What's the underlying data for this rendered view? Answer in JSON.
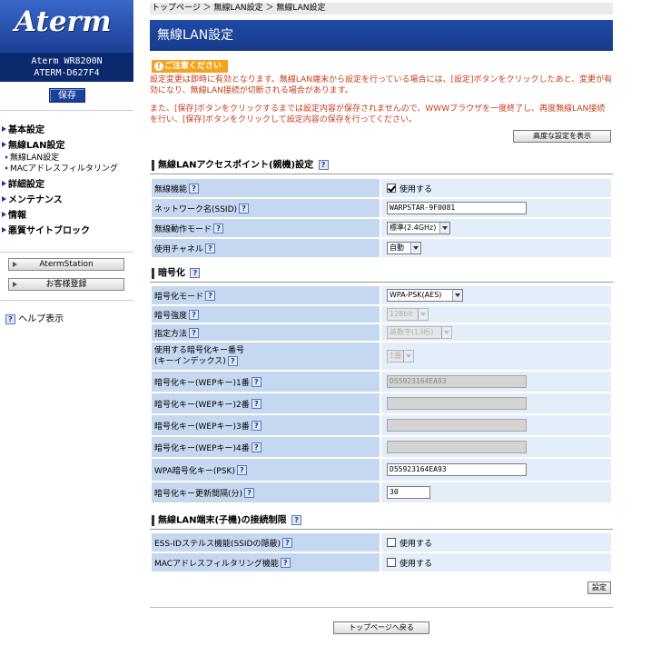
{
  "sidebar": {
    "logo": "Aterm",
    "model_line1": "Aterm WR8200N",
    "model_line2": "ATERM-D627F4",
    "save_label": "保存",
    "menu": {
      "basic": "基本設定",
      "wireless": "無線LAN設定",
      "wireless_sub1": "無線LAN設定",
      "wireless_sub2": "MACアドレスフィルタリング",
      "advanced": "詳細設定",
      "maintenance": "メンテナンス",
      "info": "情報",
      "block": "悪質サイトブロック"
    },
    "aterm_station": "AtermStation",
    "customer_reg": "お客様登録",
    "help": "ヘルプ表示"
  },
  "breadcrumb": "トップページ ＞ 無線LAN設定 ＞ 無線LAN設定",
  "page_title": "無線LAN設定",
  "caution": "ご注意ください",
  "notice1": "設定変更は即時に有効となります。無線LAN端末から設定を行っている場合には、[設定]ボタンをクリックしたあと、変更が有効になり、無線LAN接続が切断される場合があります。",
  "notice2": "また、[保存]ボタンをクリックするまでは設定内容が保存されませんので、WWWブラウザを一度終了し、再度無線LAN接続を行い、[保存]ボタンをクリックして設定内容の保存を行ってください。",
  "advanced_button": "高度な設定を表示",
  "sections": {
    "ap": "無線LANアクセスポイント(親機)設定",
    "enc": "暗号化",
    "client": "無線LAN端末(子機)の接続制限"
  },
  "fields": {
    "wireless_func": {
      "label": "無線機能",
      "value": "使用する"
    },
    "ssid": {
      "label": "ネットワーク名(SSID)",
      "value": "WARPSTAR-9F0081"
    },
    "mode": {
      "label": "無線動作モード",
      "value": "標準(2.4GHz)"
    },
    "channel": {
      "label": "使用チャネル",
      "value": "自動"
    },
    "enc_mode": {
      "label": "暗号化モード",
      "value": "WPA-PSK(AES)"
    },
    "enc_strength": {
      "label": "暗号強度",
      "value": "128bit"
    },
    "spec_method": {
      "label": "指定方法",
      "value": "英数字(13桁)"
    },
    "key_index_l1": "使用する暗号化キー番号",
    "key_index_l2": "(キーインデックス)",
    "key_index_value": "1番",
    "wep1": {
      "label": "暗号化キー(WEPキー)1番",
      "value": "D55923164EA93"
    },
    "wep2": {
      "label": "暗号化キー(WEPキー)2番",
      "value": ""
    },
    "wep3": {
      "label": "暗号化キー(WEPキー)3番",
      "value": ""
    },
    "wep4": {
      "label": "暗号化キー(WEPキー)4番",
      "value": ""
    },
    "psk": {
      "label": "WPA暗号化キー(PSK)",
      "value": "D55923164EA93"
    },
    "interval": {
      "label": "暗号化キー更新間隔(分)",
      "value": "30"
    },
    "stealth": {
      "label": "ESS-IDステルス機能(SSIDの隠蔽)",
      "value": "使用する"
    },
    "mac_filter": {
      "label": "MACアドレスフィルタリング機能",
      "value": "使用する"
    }
  },
  "set_button": "設定",
  "top_button": "トップページへ戻る"
}
